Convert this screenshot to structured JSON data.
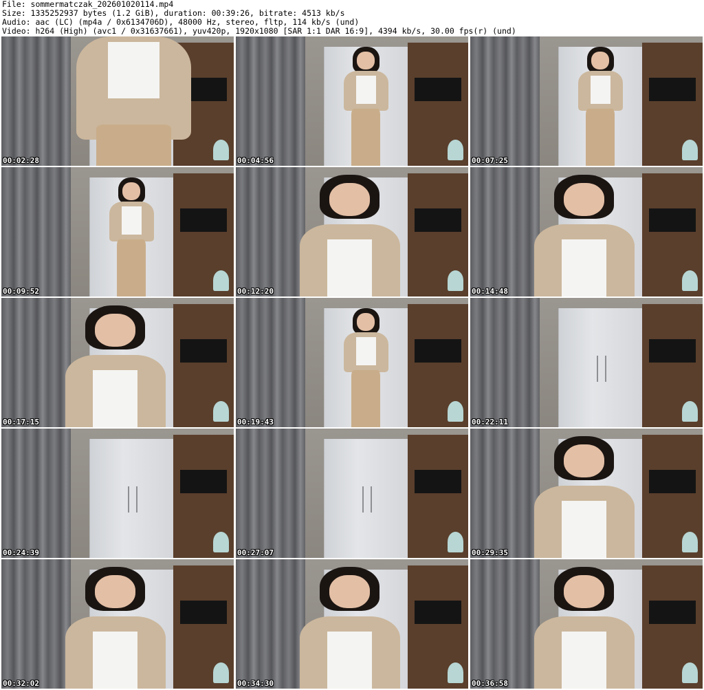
{
  "header": {
    "file": "File: sommermatczak_202601020114.mp4",
    "size": "Size: 1335252937 bytes (1.2 GiB), duration: 00:39:26, bitrate: 4513 kb/s",
    "audio": "Audio: aac (LC) (mp4a / 0x6134706D), 48000 Hz, stereo, fltp, 114 kb/s (und)",
    "video": "Video: h264 (High) (avc1 / 0x31637661), yuv420p, 1920x1080 [SAR 1:1 DAR 16:9], 4394 kb/s, 30.00 fps(r) (und)"
  },
  "thumbnails": [
    {
      "timestamp": "00:02:28"
    },
    {
      "timestamp": "00:04:56"
    },
    {
      "timestamp": "00:07:25"
    },
    {
      "timestamp": "00:09:52"
    },
    {
      "timestamp": "00:12:20"
    },
    {
      "timestamp": "00:14:48"
    },
    {
      "timestamp": "00:17:15"
    },
    {
      "timestamp": "00:19:43"
    },
    {
      "timestamp": "00:22:11"
    },
    {
      "timestamp": "00:24:39"
    },
    {
      "timestamp": "00:27:07"
    },
    {
      "timestamp": "00:29:35"
    },
    {
      "timestamp": "00:32:02"
    },
    {
      "timestamp": "00:34:30"
    },
    {
      "timestamp": "00:36:58"
    }
  ]
}
